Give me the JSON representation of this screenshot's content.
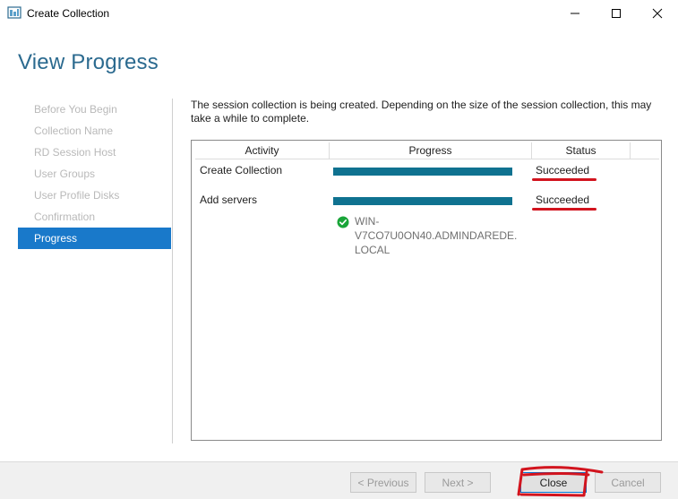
{
  "window": {
    "title": "Create Collection"
  },
  "page": {
    "title": "View Progress",
    "description": "The session collection is being created. Depending on the size of the session collection, this may take a while to complete."
  },
  "nav": {
    "items": [
      {
        "label": "Before You Begin",
        "active": false
      },
      {
        "label": "Collection Name",
        "active": false
      },
      {
        "label": "RD Session Host",
        "active": false
      },
      {
        "label": "User Groups",
        "active": false
      },
      {
        "label": "User Profile Disks",
        "active": false
      },
      {
        "label": "Confirmation",
        "active": false
      },
      {
        "label": "Progress",
        "active": true
      }
    ]
  },
  "grid": {
    "columns": [
      "Activity",
      "Progress",
      "Status"
    ],
    "rows": [
      {
        "activity": "Create Collection",
        "progress_fraction": 1.0,
        "status": "Succeeded"
      },
      {
        "activity": "Add servers",
        "progress_fraction": 1.0,
        "status": "Succeeded"
      }
    ],
    "sub_item": {
      "icon": "check-circle-icon",
      "text": "WIN-\nV7CO7U0ON40.ADMINDAREDE.\nLOCAL"
    }
  },
  "footer": {
    "previous_label": "< Previous",
    "next_label": "Next >",
    "close_label": "Close",
    "cancel_label": "Cancel"
  },
  "colors": {
    "accent": "#1979ca",
    "title": "#2b6a8f",
    "progress": "#0f7290",
    "annotation": "#d2141e",
    "success": "#19a539"
  }
}
